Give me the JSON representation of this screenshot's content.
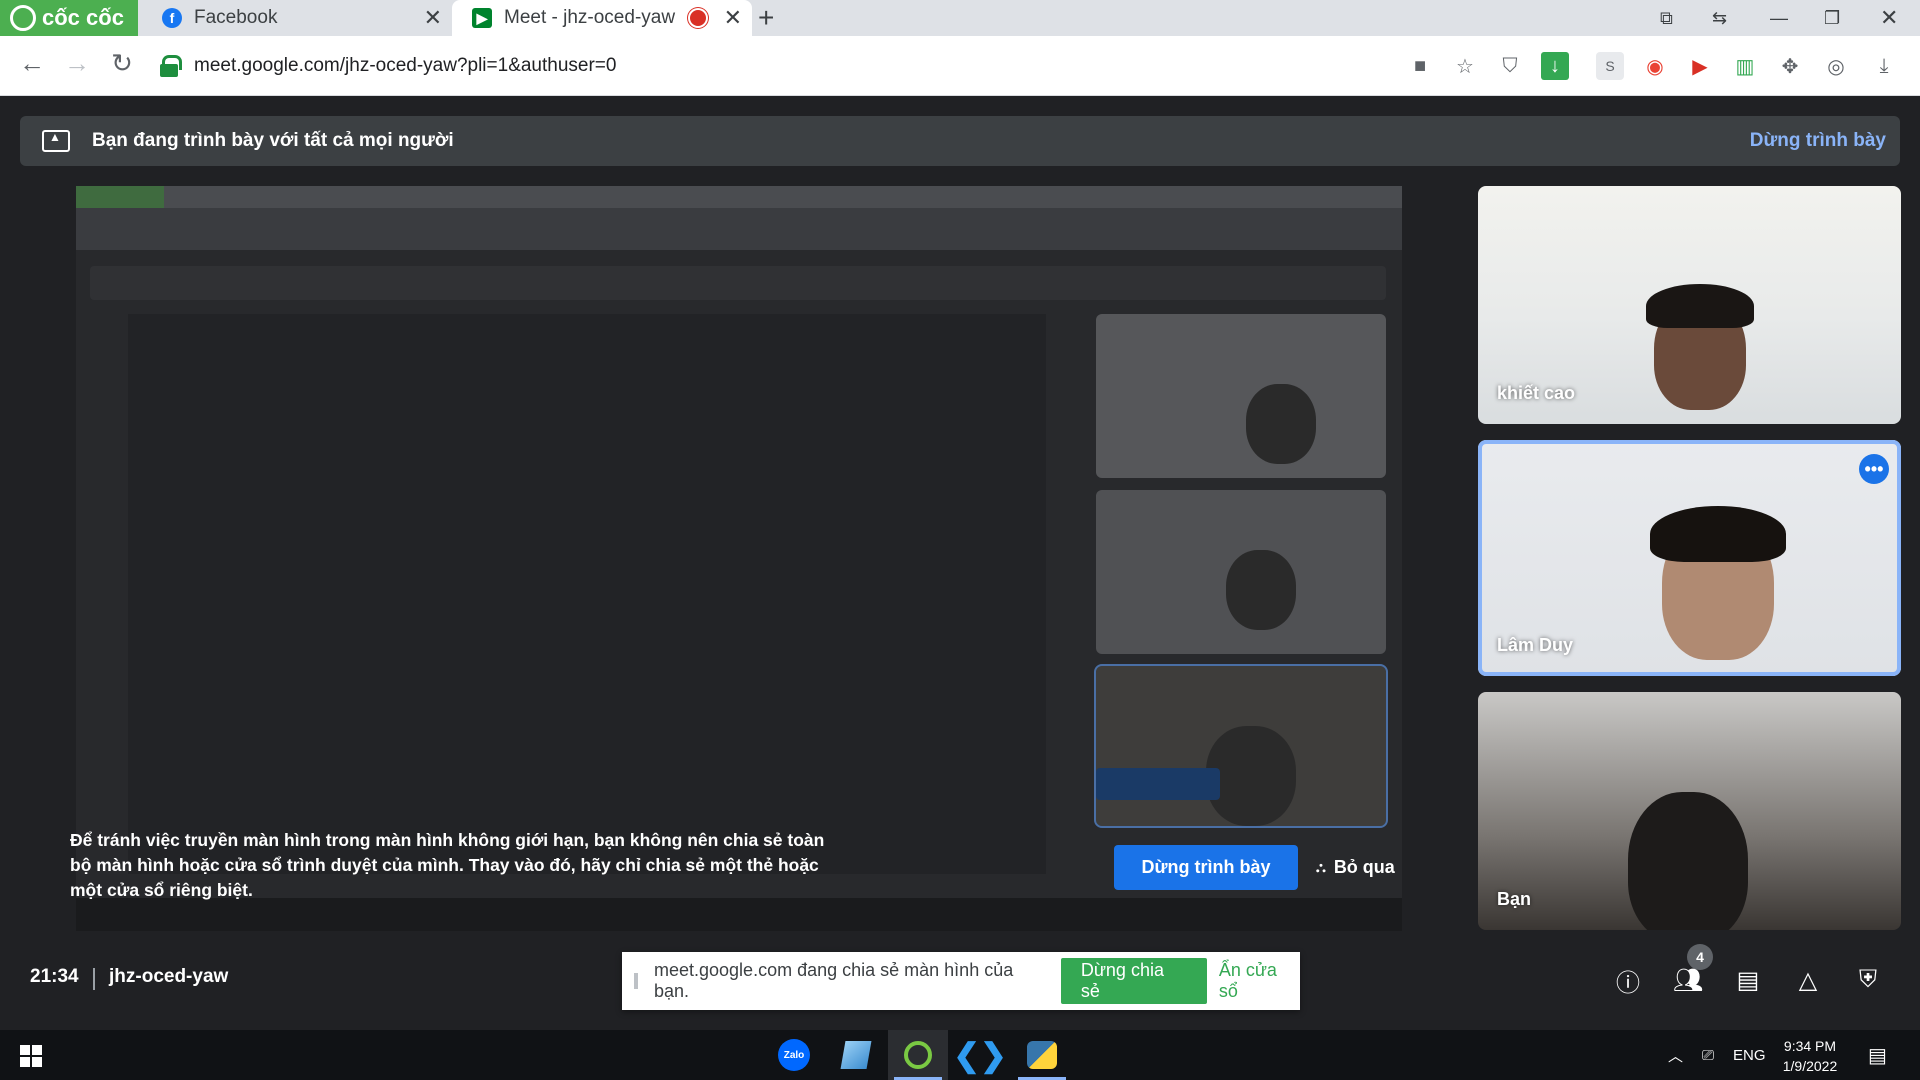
{
  "browser": {
    "brand": "cốc cốc",
    "tabs": [
      {
        "title": "Facebook",
        "icon": "facebook-icon"
      },
      {
        "title": "Meet - jhz-oced-yaw",
        "icon": "meet-icon",
        "recording": true
      }
    ],
    "url": "meet.google.com/jhz-oced-yaw?pli=1&authuser=0"
  },
  "meet": {
    "presenting_banner": "Bạn đang trình bày với tất cả mọi người",
    "stop_presenting_link": "Dừng trình bày",
    "warning": "Để tránh việc truyền màn hình trong màn hình không giới hạn, bạn không nên chia sẻ toàn bộ màn hình hoặc cửa sổ trình duyệt của mình. Thay vào đó, hãy chỉ chia sẻ một thẻ hoặc một cửa sổ riêng biệt.",
    "stop_presenting_button": "Dừng trình bày",
    "skip_button": "Bỏ qua",
    "participants": [
      {
        "name": "khiết cao"
      },
      {
        "name": "Lâm Duy"
      },
      {
        "name": "Bạn"
      }
    ],
    "time": "21:34",
    "meeting_code": "jhz-oced-yaw",
    "participant_count": "4",
    "share_bar": {
      "text": "meet.google.com đang chia sẻ màn hình của bạn.",
      "stop_share": "Dừng chia sẻ",
      "hide": "Ẩn cửa sổ"
    }
  },
  "taskbar": {
    "language": "ENG",
    "time": "9:34 PM",
    "date": "1/9/2022",
    "apps": [
      "zalo-icon",
      "files-icon",
      "coccoc-icon",
      "vscode-icon",
      "python-icon"
    ]
  },
  "colors": {
    "meet_bg": "#202124",
    "accent_blue": "#1a73e8",
    "link_blue": "#8ab4f8",
    "share_green": "#34a853",
    "brand_green": "#4caf50"
  }
}
